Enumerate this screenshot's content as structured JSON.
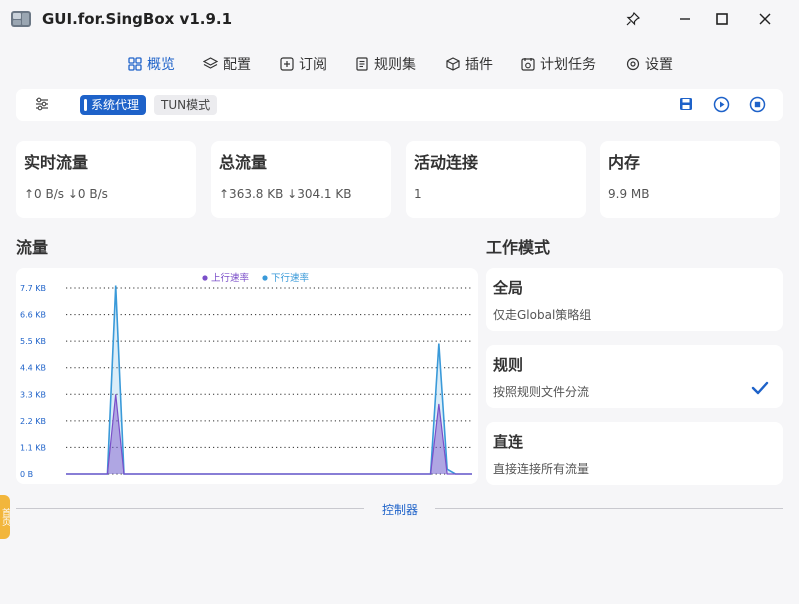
{
  "app": {
    "title": "GUI.for.SingBox v1.9.1"
  },
  "nav": [
    {
      "label": "概览",
      "icon": "overview-grid-icon",
      "active": true
    },
    {
      "label": "配置",
      "icon": "layers-icon",
      "active": false
    },
    {
      "label": "订阅",
      "icon": "subscription-plus-icon",
      "active": false
    },
    {
      "label": "规则集",
      "icon": "ruleset-list-icon",
      "active": false
    },
    {
      "label": "插件",
      "icon": "plugin-box-icon",
      "active": false
    },
    {
      "label": "计划任务",
      "icon": "scheduled-tasks-icon",
      "active": false
    },
    {
      "label": "设置",
      "icon": "settings-gear-icon",
      "active": false
    }
  ],
  "toolbar": {
    "system_proxy_label": "系统代理",
    "tun_label": "TUN模式"
  },
  "stats": [
    {
      "title": "实时流量",
      "value": "↑0 B/s ↓0 B/s"
    },
    {
      "title": "总流量",
      "value": "↑363.8 KB ↓304.1 KB"
    },
    {
      "title": "活动连接",
      "value": "1"
    },
    {
      "title": "内存",
      "value": "9.9 MB"
    }
  ],
  "traffic_section_title": "流量",
  "mode_section_title": "工作模式",
  "modes": [
    {
      "title": "全局",
      "desc": "仅走Global策略组",
      "selected": false
    },
    {
      "title": "规则",
      "desc": "按照规则文件分流",
      "selected": true
    },
    {
      "title": "直连",
      "desc": "直接连接所有流量",
      "selected": false
    }
  ],
  "controller_label": "控制器",
  "side_tab_label": "首页",
  "colors": {
    "accent": "#1e62c9",
    "upload": "#7b4fc9",
    "download": "#3a9ad9"
  },
  "chart_data": {
    "type": "area",
    "legend": [
      "上行速率",
      "下行速率"
    ],
    "legend_position": "top-center",
    "y_ticks": [
      "0 B",
      "1.1 KB",
      "2.2 KB",
      "3.3 KB",
      "4.4 KB",
      "5.5 KB",
      "6.6 KB",
      "7.7 KB"
    ],
    "ylim": [
      0,
      7.7
    ],
    "y_unit": "KB",
    "grid": true,
    "x": [
      0,
      1,
      2,
      3,
      4,
      5,
      6,
      7,
      8,
      9,
      10,
      11,
      12,
      13,
      14,
      15,
      16,
      17,
      18,
      19,
      20,
      21,
      22,
      23,
      24,
      25,
      26,
      27,
      28,
      29,
      30,
      31,
      32,
      33,
      34,
      35,
      36,
      37,
      38,
      39,
      40,
      41,
      42,
      43,
      44,
      45,
      46,
      47,
      48,
      49
    ],
    "series": [
      {
        "name": "上行速率",
        "values": [
          0,
          0,
          0,
          0,
          0,
          0,
          3.3,
          0,
          0,
          0,
          0,
          0,
          0,
          0,
          0,
          0,
          0,
          0,
          0,
          0,
          0,
          0,
          0,
          0,
          0,
          0,
          0,
          0,
          0,
          0,
          0,
          0,
          0,
          0,
          0,
          0,
          0,
          0,
          0,
          0,
          0,
          0,
          0,
          0,
          0,
          2.9,
          0,
          0,
          0,
          0
        ]
      },
      {
        "name": "下行速率",
        "values": [
          0,
          0,
          0,
          0,
          0,
          0,
          7.8,
          0,
          0,
          0,
          0,
          0,
          0,
          0,
          0,
          0,
          0,
          0,
          0,
          0,
          0,
          0,
          0,
          0,
          0,
          0,
          0,
          0,
          0,
          0,
          0,
          0,
          0,
          0,
          0,
          0,
          0,
          0,
          0,
          0,
          0,
          0,
          0,
          0,
          0,
          5.4,
          0.2,
          0,
          0,
          0
        ]
      }
    ]
  }
}
